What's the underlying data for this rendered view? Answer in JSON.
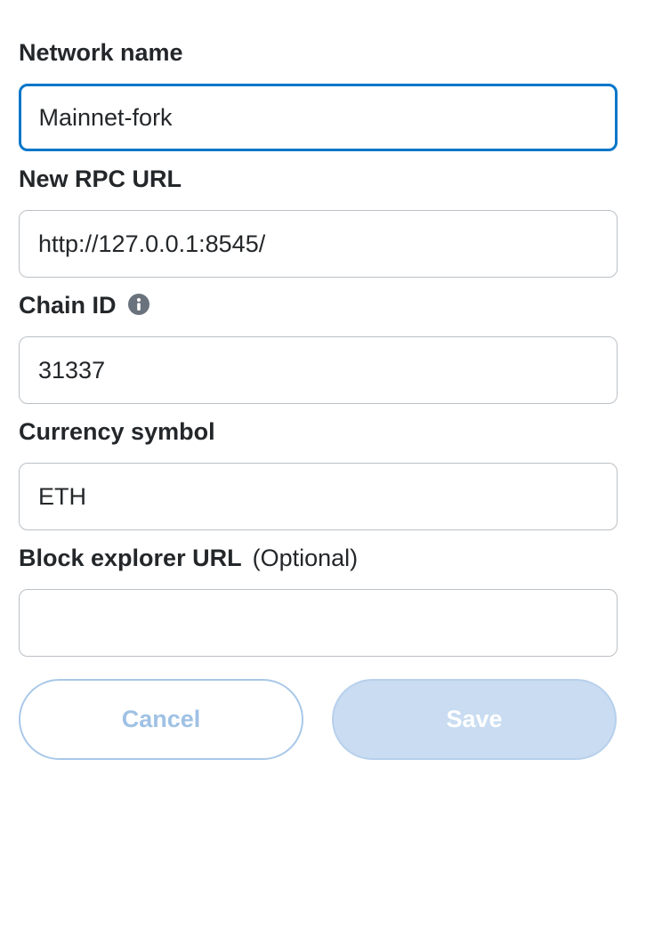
{
  "form": {
    "network_name": {
      "label": "Network name",
      "value": "Mainnet-fork"
    },
    "rpc_url": {
      "label": "New RPC URL",
      "value": "http://127.0.0.1:8545/"
    },
    "chain_id": {
      "label": "Chain ID",
      "value": "31337",
      "icon": "info-icon"
    },
    "currency_symbol": {
      "label": "Currency symbol",
      "value": "ETH"
    },
    "block_explorer": {
      "label": "Block explorer URL",
      "optional_note": "(Optional)",
      "value": ""
    }
  },
  "actions": {
    "cancel_label": "Cancel",
    "save_label": "Save"
  },
  "colors": {
    "focus_border": "#0376c9",
    "input_border": "#bbc0c5",
    "cancel_border": "#a9c8e9",
    "cancel_text": "#9fc1e4",
    "save_background": "#c9dcf1"
  }
}
